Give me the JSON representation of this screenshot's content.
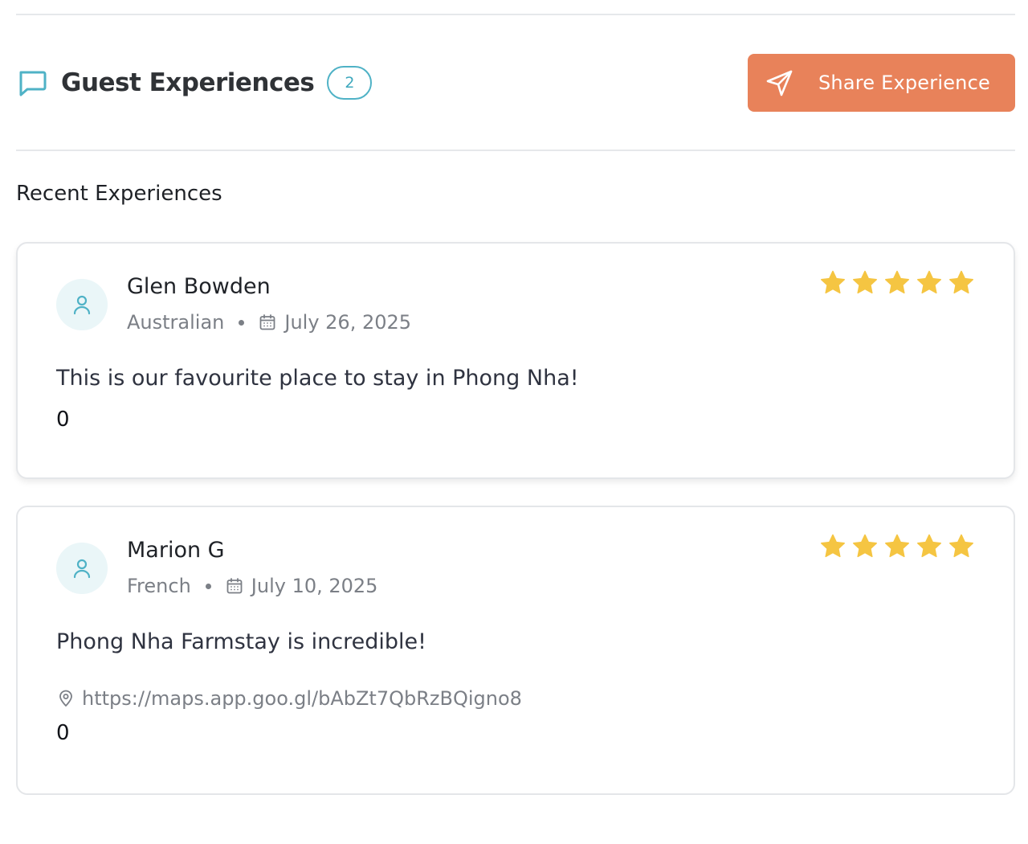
{
  "header": {
    "title": "Guest Experiences",
    "count": "2",
    "share_label": "Share Experience"
  },
  "section_title": "Recent Experiences",
  "colors": {
    "accent_teal": "#4fb2c6",
    "share_button": "#e8825a",
    "star": "#f5c542"
  },
  "reviews": [
    {
      "name": "Glen Bowden",
      "nationality": "Australian",
      "date": "July 26, 2025",
      "rating": 5,
      "text": "This is our favourite place to stay in Phong Nha!",
      "likes": "0"
    },
    {
      "name": "Marion G",
      "nationality": "French",
      "date": "July 10, 2025",
      "rating": 5,
      "text": "Phong Nha Farmstay is incredible!",
      "location": "https://maps.app.goo.gl/bAbZt7QbRzBQigno8",
      "likes": "0"
    }
  ],
  "icons": {
    "header": "chat-bubble-icon",
    "share": "send-icon",
    "avatar": "user-icon",
    "date": "calendar-icon",
    "location": "map-pin-icon",
    "rating": "star-icon"
  }
}
